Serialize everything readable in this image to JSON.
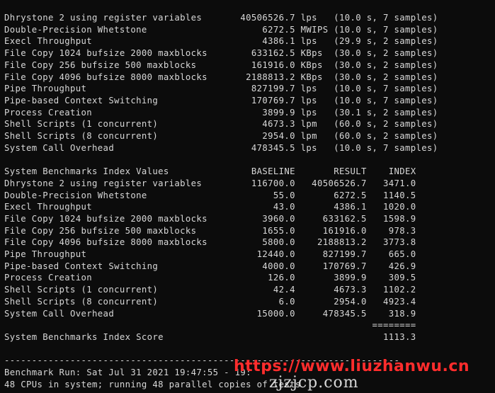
{
  "terminal": {
    "lines": [
      "Dhrystone 2 using register variables       40506526.7 lps   (10.0 s, 7 samples)",
      "Double-Precision Whetstone                     6272.5 MWIPS (10.0 s, 7 samples)",
      "Execl Throughput                               4386.1 lps   (29.9 s, 2 samples)",
      "File Copy 1024 bufsize 2000 maxblocks        633162.5 KBps  (30.0 s, 2 samples)",
      "File Copy 256 bufsize 500 maxblocks          161916.0 KBps  (30.0 s, 2 samples)",
      "File Copy 4096 bufsize 8000 maxblocks       2188813.2 KBps  (30.0 s, 2 samples)",
      "Pipe Throughput                              827199.7 lps   (10.0 s, 7 samples)",
      "Pipe-based Context Switching                 170769.7 lps   (10.0 s, 7 samples)",
      "Process Creation                               3899.9 lps   (30.1 s, 2 samples)",
      "Shell Scripts (1 concurrent)                   4673.3 lpm   (60.0 s, 2 samples)",
      "Shell Scripts (8 concurrent)                   2954.0 lpm   (60.0 s, 2 samples)",
      "System Call Overhead                         478345.5 lps   (10.0 s, 7 samples)",
      "",
      "System Benchmarks Index Values               BASELINE       RESULT    INDEX",
      "Dhrystone 2 using register variables         116700.0   40506526.7   3471.0",
      "Double-Precision Whetstone                       55.0       6272.5   1140.5",
      "Execl Throughput                                 43.0       4386.1   1020.0",
      "File Copy 1024 bufsize 2000 maxblocks          3960.0     633162.5   1598.9",
      "File Copy 256 bufsize 500 maxblocks            1655.0     161916.0    978.3",
      "File Copy 4096 bufsize 8000 maxblocks          5800.0    2188813.2   3773.8",
      "Pipe Throughput                               12440.0     827199.7    665.0",
      "Pipe-based Context Switching                   4000.0     170769.7    426.9",
      "Process Creation                                126.0       3899.9    309.5",
      "Shell Scripts (1 concurrent)                     42.4       4673.3   1102.2",
      "Shell Scripts (8 concurrent)                      6.0       2954.0   4923.4",
      "System Call Overhead                          15000.0     478345.5    318.9",
      "                                                                   ========",
      "System Benchmarks Index Score                                        1113.3",
      "",
      "------------------------------------------------------------------------",
      "Benchmark Run: Sat Jul 31 2021 19:47:55 - 19:",
      "48 CPUs in system; running 48 parallel copies of tests"
    ]
  },
  "watermark": {
    "url": "https://www.liuzhanwu.cn",
    "site": "zjzjcp.com"
  },
  "colors": {
    "background": "#0c0c0c",
    "text": "#d8d8d8",
    "watermark_url": "#ff2d2d"
  }
}
